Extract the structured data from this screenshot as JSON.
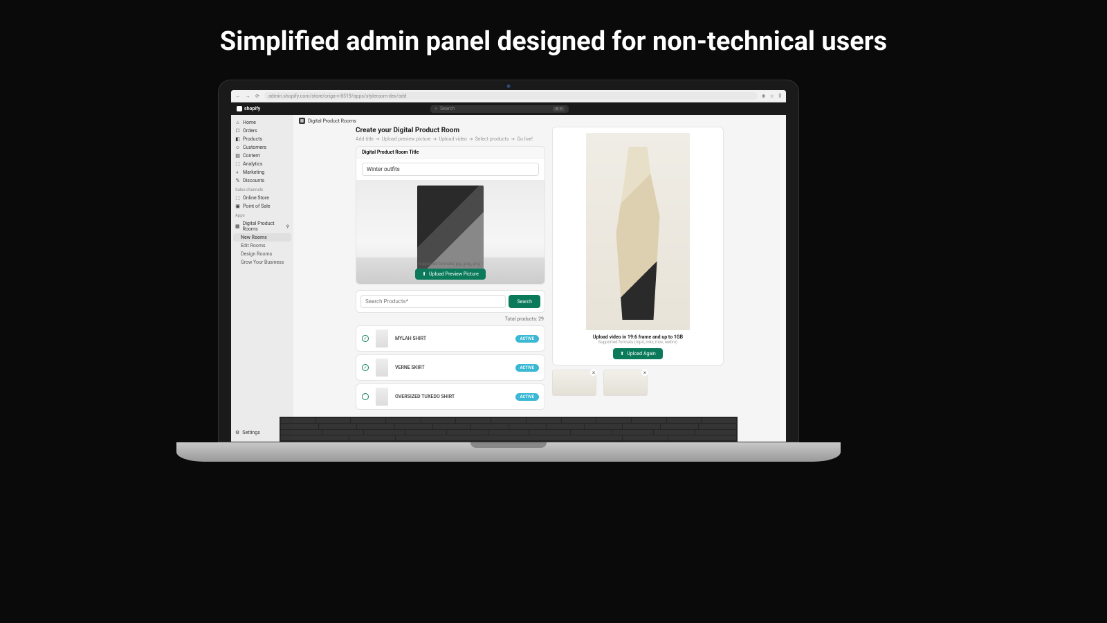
{
  "hero": "Simplified admin panel designed for non-technical users",
  "browser": {
    "url": "admin.shopify.com/store/origa-v-8519/apps/styleroom-dev/add"
  },
  "topbar": {
    "brand": "shopify",
    "search_placeholder": "Search",
    "kbd": "⌘ K"
  },
  "sidebar": {
    "main": [
      {
        "icon": "⌂",
        "label": "Home"
      },
      {
        "icon": "☐",
        "label": "Orders"
      },
      {
        "icon": "◧",
        "label": "Products"
      },
      {
        "icon": "☺",
        "label": "Customers"
      },
      {
        "icon": "▤",
        "label": "Content"
      },
      {
        "icon": "⬚",
        "label": "Analytics"
      },
      {
        "icon": "◐",
        "label": "Marketing"
      },
      {
        "icon": "%",
        "label": "Discounts"
      }
    ],
    "channels_label": "Sales channels",
    "channels": [
      {
        "icon": "⬚",
        "label": "Online Store"
      },
      {
        "icon": "▣",
        "label": "Point of Sale"
      }
    ],
    "apps_label": "Apps",
    "app": {
      "icon": "▦",
      "label": "Digital Product Rooms"
    },
    "app_sub": [
      "New Rooms",
      "Edit Rooms",
      "Design Rooms",
      "Grow Your Business"
    ],
    "settings": "Settings"
  },
  "page": {
    "tag": "Digital Product Rooms",
    "title": "Create your Digital Product Room",
    "steps": [
      "Add title",
      "Upload preview picture",
      "Upload video",
      "Select products",
      "Go live!"
    ],
    "title_field_label": "Digital Product Room Title",
    "title_value": "Winter outfits",
    "formats_hint": "Supported formats( jpg, jpeg, png )",
    "upload_preview_btn": "Upload Preview Picture",
    "search_placeholder": "Search Products*",
    "search_btn": "Search",
    "total_label": "Total products: 29",
    "products": [
      {
        "name": "MYLAH SHIRT",
        "status": "ACTIVE",
        "checked": true
      },
      {
        "name": "VERNE SKIRT",
        "status": "ACTIVE",
        "checked": true
      },
      {
        "name": "OVERSIZED TUXEDO SHIRT",
        "status": "ACTIVE",
        "checked": false
      }
    ],
    "video_note": "Upload video in 19:6 frame and up to 1GB",
    "video_sub": "Supported formats (mp4, mkv, mov, webm)",
    "upload_again_btn": "Upload Again"
  }
}
